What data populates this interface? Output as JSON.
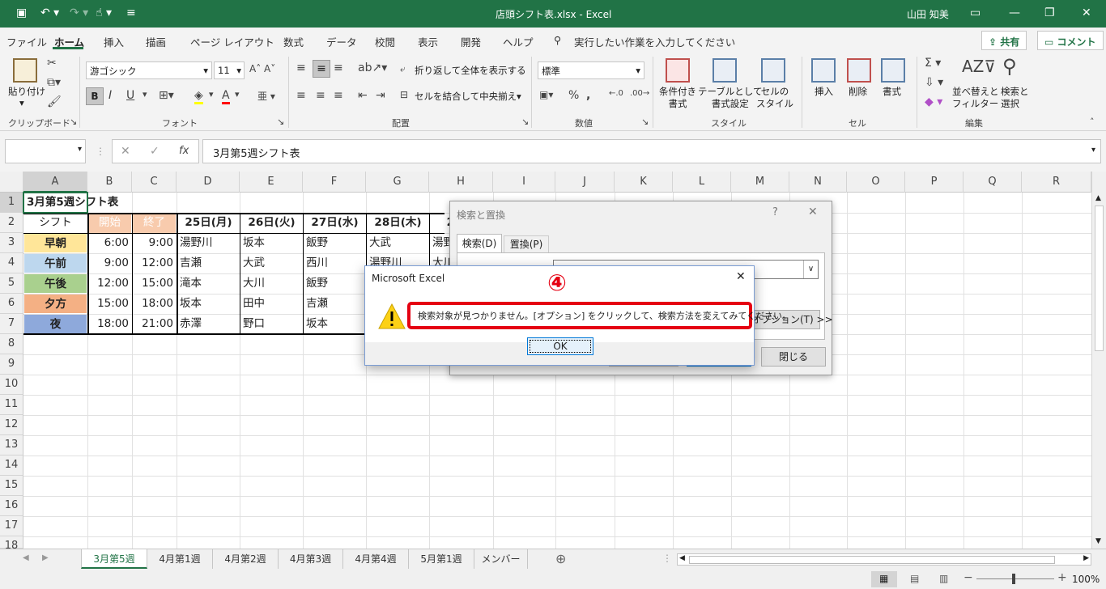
{
  "window": {
    "title": "店頭シフト表.xlsx  -  Excel",
    "user": "山田 知美"
  },
  "menu": {
    "items": [
      "ファイル",
      "ホーム",
      "挿入",
      "描画",
      "ページ レイアウト",
      "数式",
      "データ",
      "校閲",
      "表示",
      "開発",
      "ヘルプ"
    ],
    "search": "実行したい作業を入力してください",
    "share": "共有",
    "comment": "コメント"
  },
  "ribbon": {
    "clipboard": {
      "paste": "貼り付け",
      "group": "クリップボード"
    },
    "font": {
      "name": "游ゴシック",
      "size": "11",
      "group": "フォント",
      "bold": "B",
      "italic": "I",
      "underline": "U"
    },
    "align": {
      "wrap": "折り返して全体を表示する",
      "merge": "セルを結合して中央揃え",
      "group": "配置"
    },
    "number": {
      "format": "標準",
      "group": "数値"
    },
    "styles": {
      "cond": "条件付き\n書式",
      "table": "テーブルとして\n書式設定",
      "cell": "セルの\nスタイル",
      "group": "スタイル"
    },
    "cells": {
      "insert": "挿入",
      "delete": "削除",
      "format": "書式",
      "group": "セル"
    },
    "edit": {
      "sort": "並べ替えと\nフィルター",
      "find": "検索と\n選択",
      "group": "編集"
    }
  },
  "formula_bar": {
    "value": "3月第5週シフト表",
    "fx": "fx"
  },
  "columns": [
    "A",
    "B",
    "C",
    "D",
    "E",
    "F",
    "G",
    "H",
    "I",
    "J",
    "K",
    "L",
    "M",
    "N",
    "O",
    "P",
    "Q",
    "R"
  ],
  "rows": [
    "1",
    "2",
    "3",
    "4",
    "5",
    "6",
    "7",
    "8",
    "9",
    "10",
    "11",
    "12",
    "13",
    "14",
    "15",
    "16",
    "17",
    "18"
  ],
  "sheet": {
    "title": "3月第5週シフト表",
    "header": [
      "シフト",
      "開始",
      "終了",
      "25日(月)",
      "26日(火)",
      "27日(水)",
      "28日(木)",
      "29"
    ],
    "shifts": [
      {
        "name": "早朝",
        "start": "6:00",
        "end": "9:00",
        "d25": "湯野川",
        "d26": "坂本",
        "d27": "飯野",
        "d28": "大武",
        "d29": "湯野"
      },
      {
        "name": "午前",
        "start": "9:00",
        "end": "12:00",
        "d25": "吉瀬",
        "d26": "大武",
        "d27": "西川",
        "d28": "湯野川",
        "d29": "大川"
      },
      {
        "name": "午後",
        "start": "12:00",
        "end": "15:00",
        "d25": "滝本",
        "d26": "大川",
        "d27": "飯野",
        "d28": "",
        "d29": ""
      },
      {
        "name": "夕方",
        "start": "15:00",
        "end": "18:00",
        "d25": "坂本",
        "d26": "田中",
        "d27": "吉瀬",
        "d28": "",
        "d29": ""
      },
      {
        "name": "夜",
        "start": "18:00",
        "end": "21:00",
        "d25": "赤澤",
        "d26": "野口",
        "d27": "坂本",
        "d28": "",
        "d29": ""
      }
    ]
  },
  "colors": {
    "brand": "#217346",
    "early": "#ffe699",
    "morning": "#bdd7ee",
    "afternoon": "#a9d08e",
    "evening": "#f4b084",
    "night": "#8ea9db",
    "start_hdr": "#f8cbad",
    "highlight": "#e50012"
  },
  "tabs": [
    "3月第5週",
    "4月第1週",
    "4月第2週",
    "4月第3週",
    "4月第4週",
    "5月第1週",
    "メンバー"
  ],
  "status": {
    "zoom": "100%"
  },
  "find_dialog": {
    "title": "検索と置換",
    "tab_find": "検索(D)",
    "tab_replace": "置換(P)",
    "options": "オプション(T) >>",
    "close": "閉じる",
    "help": "?"
  },
  "message": {
    "title": "Microsoft Excel",
    "text": "検索対象が見つかりません。[オプション] をクリックして、検索方法を変えてみてください。",
    "ok": "OK",
    "step": "④"
  }
}
